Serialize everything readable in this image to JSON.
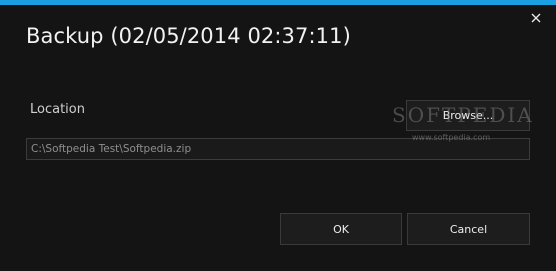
{
  "dialog": {
    "title": "Backup (02/05/2014 02:37:11)",
    "accent_color": "#1ba1e2",
    "close_icon": "close-icon"
  },
  "location": {
    "label": "Location",
    "path_value": "C:\\Softpedia Test\\Softpedia.zip",
    "browse_label": "Browse..."
  },
  "watermark": {
    "brand": "SOFTPEDIA",
    "url": "www.softpedia.com"
  },
  "actions": {
    "ok_label": "OK",
    "cancel_label": "Cancel"
  }
}
